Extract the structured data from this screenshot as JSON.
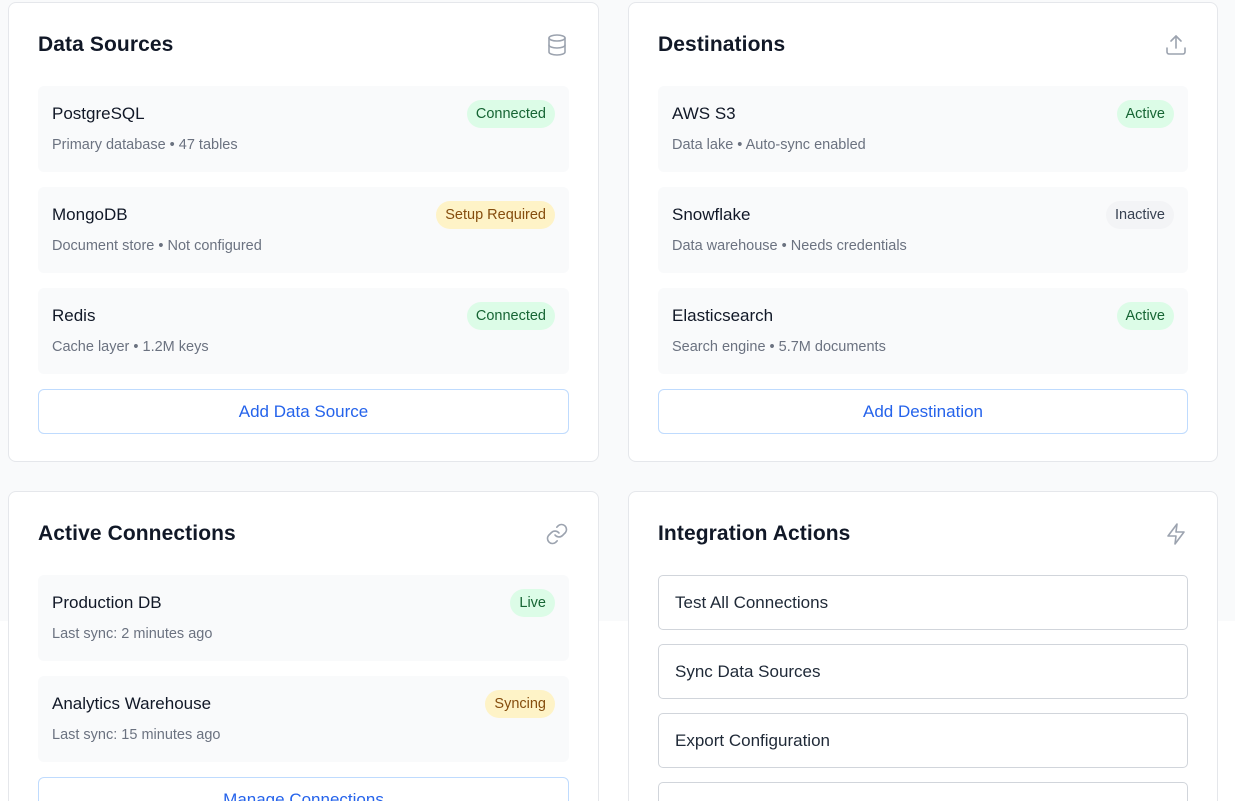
{
  "sources": {
    "title": "Data Sources",
    "icon": "database-icon",
    "items": [
      {
        "name": "PostgreSQL",
        "desc": "Primary database • 47 tables",
        "status": "Connected",
        "status_color": "#dcfce7"
      },
      {
        "name": "MongoDB",
        "desc": "Document store • Not configured",
        "status": "Setup Required",
        "status_color": "#fef3c7"
      },
      {
        "name": "Redis",
        "desc": "Cache layer • 1.2M keys",
        "status": "Connected",
        "status_color": "#dcfce7"
      }
    ],
    "add_label": "Add Data Source"
  },
  "destinations": {
    "title": "Destinations",
    "icon": "upload-icon",
    "items": [
      {
        "name": "AWS S3",
        "desc": "Data lake • Auto-sync enabled",
        "status": "Active",
        "status_color": "#dcfce7"
      },
      {
        "name": "Snowflake",
        "desc": "Data warehouse • Needs credentials",
        "status": "Inactive",
        "status_color": "#f3f4f6"
      },
      {
        "name": "Elasticsearch",
        "desc": "Search engine • 5.7M documents",
        "status": "Active",
        "status_color": "#dcfce7"
      }
    ],
    "add_label": "Add Destination"
  },
  "connections": {
    "title": "Active Connections",
    "icon": "link-icon",
    "items": [
      {
        "name": "Production DB",
        "desc": "Last sync: 2 minutes ago",
        "status": "Live",
        "status_color": "#dcfce7"
      },
      {
        "name": "Analytics Warehouse",
        "desc": "Last sync: 15 minutes ago",
        "status": "Syncing",
        "status_color": "#fef3c7"
      }
    ],
    "manage_label": "Manage Connections"
  },
  "actions": {
    "title": "Integration Actions",
    "icon": "lightning-icon",
    "buttons": [
      {
        "label": "Test All Connections"
      },
      {
        "label": "Sync Data Sources"
      },
      {
        "label": "Export Configuration"
      },
      {
        "label": ""
      }
    ]
  },
  "colors": {
    "accent": "#2563eb",
    "success_bg": "#dcfce7",
    "warning_bg": "#fef3c7",
    "neutral_bg": "#f3f4f6"
  }
}
